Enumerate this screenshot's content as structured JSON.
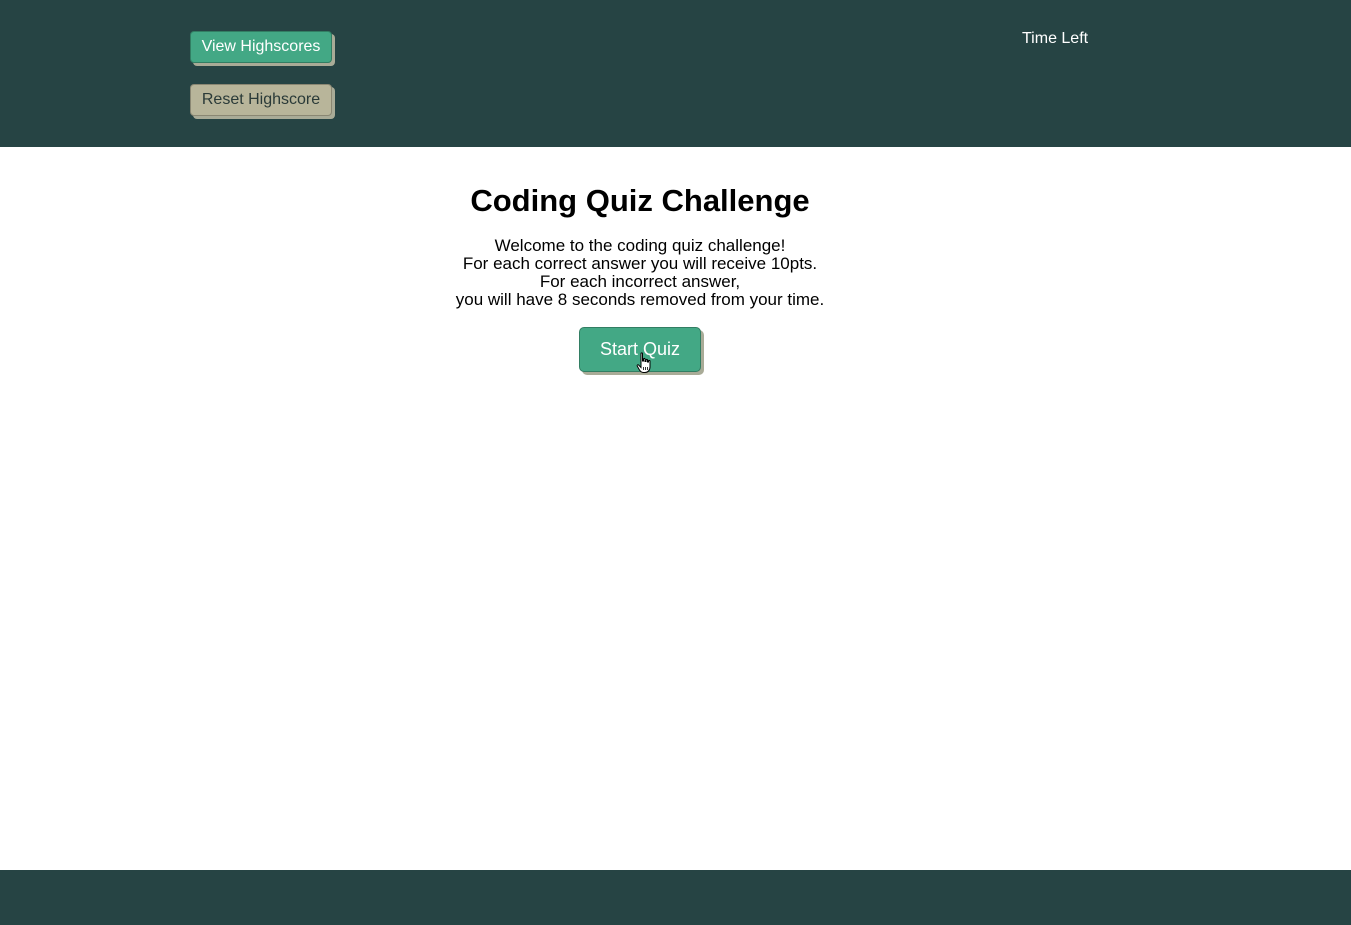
{
  "header": {
    "view_highscores_label": "View Highscores",
    "reset_highscore_label": "Reset Highscore",
    "time_left_label": "Time Left"
  },
  "main": {
    "title": "Coding Quiz Challenge",
    "intro_lines": [
      "Welcome to the coding quiz challenge!",
      "For each correct answer you will receive 10pts.",
      "For each incorrect answer,",
      "you will have 8 seconds removed from your time."
    ],
    "start_label": "Start Quiz"
  },
  "colors": {
    "header_bg": "#264444",
    "accent_green": "#43a885",
    "reset_bg": "#b8b59a",
    "button_shadow": "#a9ab97"
  },
  "cursor": {
    "icon": "hand-pointer-icon"
  }
}
